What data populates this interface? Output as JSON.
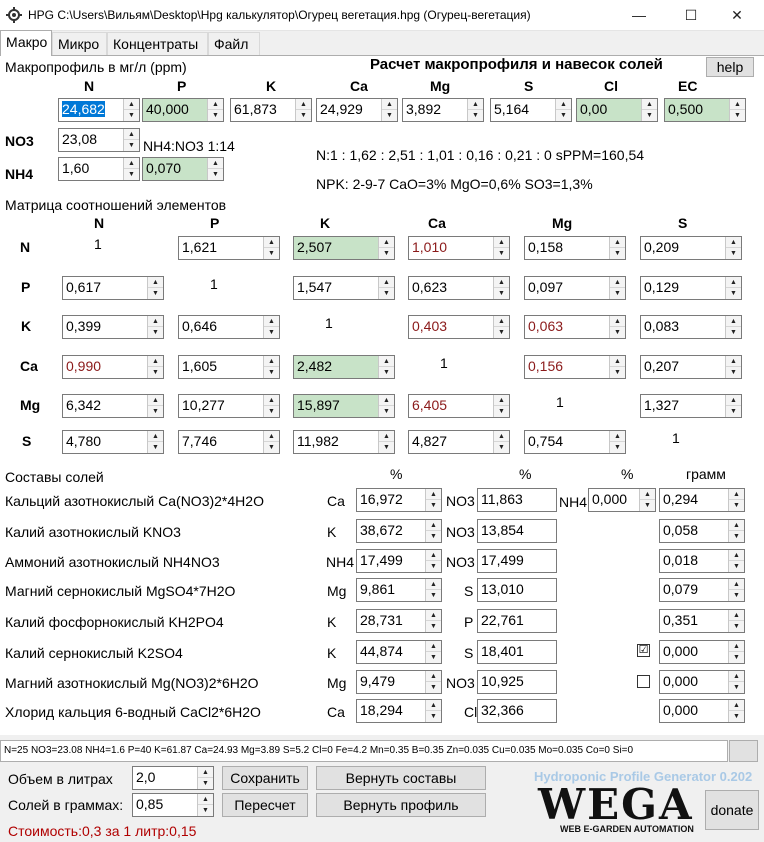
{
  "window": {
    "title": "HPG C:\\Users\\Вильям\\Desktop\\Hpg калькулятор\\Огурец вегетация.hpg (Огурец-вегетация)",
    "minimize_glyph": "—",
    "maximize_glyph": "☐",
    "close_glyph": "✕"
  },
  "tabs": [
    "Макро",
    "Микро",
    "Концентраты",
    "Файл"
  ],
  "macro": {
    "profile_label": "Макропрофиль в мг/л (ppm)",
    "calc_title": "Расчет макропрофиля и навесок солей",
    "help_label": "help",
    "elements": [
      "N",
      "P",
      "K",
      "Ca",
      "Mg",
      "S",
      "Cl",
      "EC"
    ],
    "values": [
      "24,682",
      "40,000",
      "61,873",
      "24,929",
      "3,892",
      "5,164",
      "0,00",
      "0,500"
    ],
    "no3_label": "NO3",
    "no3_value": "23,08",
    "nh4_label": "NH4",
    "nh4_value": "1,60",
    "nh4_no3_ratio": "NH4:NO3 1:14",
    "nh4_ratio_value": "0,070",
    "ratio_line": "N:1 : 1,62 : 2,51 : 1,01 : 0,16 : 0,21 : 0 sPPM=160,54",
    "npk_line": "NPK: 2-9-7 CaO=3% MgO=0,6% SO3=1,3%"
  },
  "matrix": {
    "title": "Матрица соотношений элементов",
    "headers": [
      "N",
      "P",
      "K",
      "Ca",
      "Mg",
      "S"
    ],
    "rows": [
      {
        "label": "N",
        "cells": [
          "1",
          "1,621",
          "2,507",
          "1,010",
          "0,158",
          "0,209"
        ]
      },
      {
        "label": "P",
        "cells": [
          "0,617",
          "1",
          "1,547",
          "0,623",
          "0,097",
          "0,129"
        ]
      },
      {
        "label": "K",
        "cells": [
          "0,399",
          "0,646",
          "1",
          "0,403",
          "0,063",
          "0,083"
        ]
      },
      {
        "label": "Ca",
        "cells": [
          "0,990",
          "1,605",
          "2,482",
          "1",
          "0,156",
          "0,207"
        ]
      },
      {
        "label": "Mg",
        "cells": [
          "6,342",
          "10,277",
          "15,897",
          "6,405",
          "1",
          "1,327"
        ]
      },
      {
        "label": "S",
        "cells": [
          "4,780",
          "7,746",
          "11,982",
          "4,827",
          "0,754",
          "1"
        ]
      }
    ]
  },
  "salts": {
    "title": "Составы солей",
    "pct_label": "%",
    "gram_label": "грамм",
    "nh4_extra_label": "NH4",
    "nh4_extra_value": "0,000",
    "rows": [
      {
        "name": "Кальций азотнокислый Ca(NO3)2*4H2O",
        "el1": "Ca",
        "v1": "16,972",
        "el2": "NO3",
        "v2": "11,863",
        "grams": "0,294"
      },
      {
        "name": "Калий азотнокислый KNO3",
        "el1": "K",
        "v1": "38,672",
        "el2": "NO3",
        "v2": "13,854",
        "grams": "0,058"
      },
      {
        "name": "Аммоний азотнокислый NH4NO3",
        "el1": "NH4",
        "v1": "17,499",
        "el2": "NO3",
        "v2": "17,499",
        "grams": "0,018"
      },
      {
        "name": "Магний сернокислый MgSO4*7H2O",
        "el1": "Mg",
        "v1": "9,861",
        "el2": "S",
        "v2": "13,010",
        "grams": "0,079"
      },
      {
        "name": "Калий фосфорнокислый KH2PO4",
        "el1": "K",
        "v1": "28,731",
        "el2": "P",
        "v2": "22,761",
        "grams": "0,351"
      },
      {
        "name": "Калий сернокислый K2SO4",
        "el1": "K",
        "v1": "44,874",
        "el2": "S",
        "v2": "18,401",
        "grams": "0,000"
      },
      {
        "name": "Магний азотнокислый Mg(NO3)2*6H2O",
        "el1": "Mg",
        "v1": "9,479",
        "el2": "NO3",
        "v2": "10,925",
        "grams": "0,000"
      },
      {
        "name": "Хлорид кальция 6-водный CaCl2*6H2O",
        "el1": "Ca",
        "v1": "18,294",
        "el2": "Cl",
        "v2": "32,366",
        "grams": "0,000"
      }
    ],
    "k2so4_checked_glyph": "☑"
  },
  "status_line": "N=25 NO3=23.08 NH4=1.6 P=40 K=61.87 Ca=24.93 Mg=3.89 S=5.2 Cl=0 Fe=4.2 Mn=0.35 B=0.35 Zn=0.035 Cu=0.035 Mo=0.035 Co=0 Si=0",
  "bottom": {
    "volume_label": "Объем в литрах",
    "volume_value": "2,0",
    "salts_label": "Солей в граммах:",
    "salts_value": "0,85",
    "save_label": "Сохранить",
    "restore_comp_label": "Вернуть составы",
    "recalc_label": "Пересчет",
    "restore_profile_label": "Вернуть профиль",
    "cost_text": "Стоимость:0,3 за 1 литр:0,15",
    "generator_text": "Hydroponic Profile Generator 0.202",
    "logo_text": "WEGA",
    "logo_sub": "WEB E-GARDEN AUTOMATION",
    "donate_label": "donate"
  },
  "colors": {
    "selection": "#0078d7",
    "green_field": "#c8e3c8",
    "red_text": "#8b1a1a",
    "cost_text": "#b00000",
    "logo_green": "#5cbf2a"
  }
}
